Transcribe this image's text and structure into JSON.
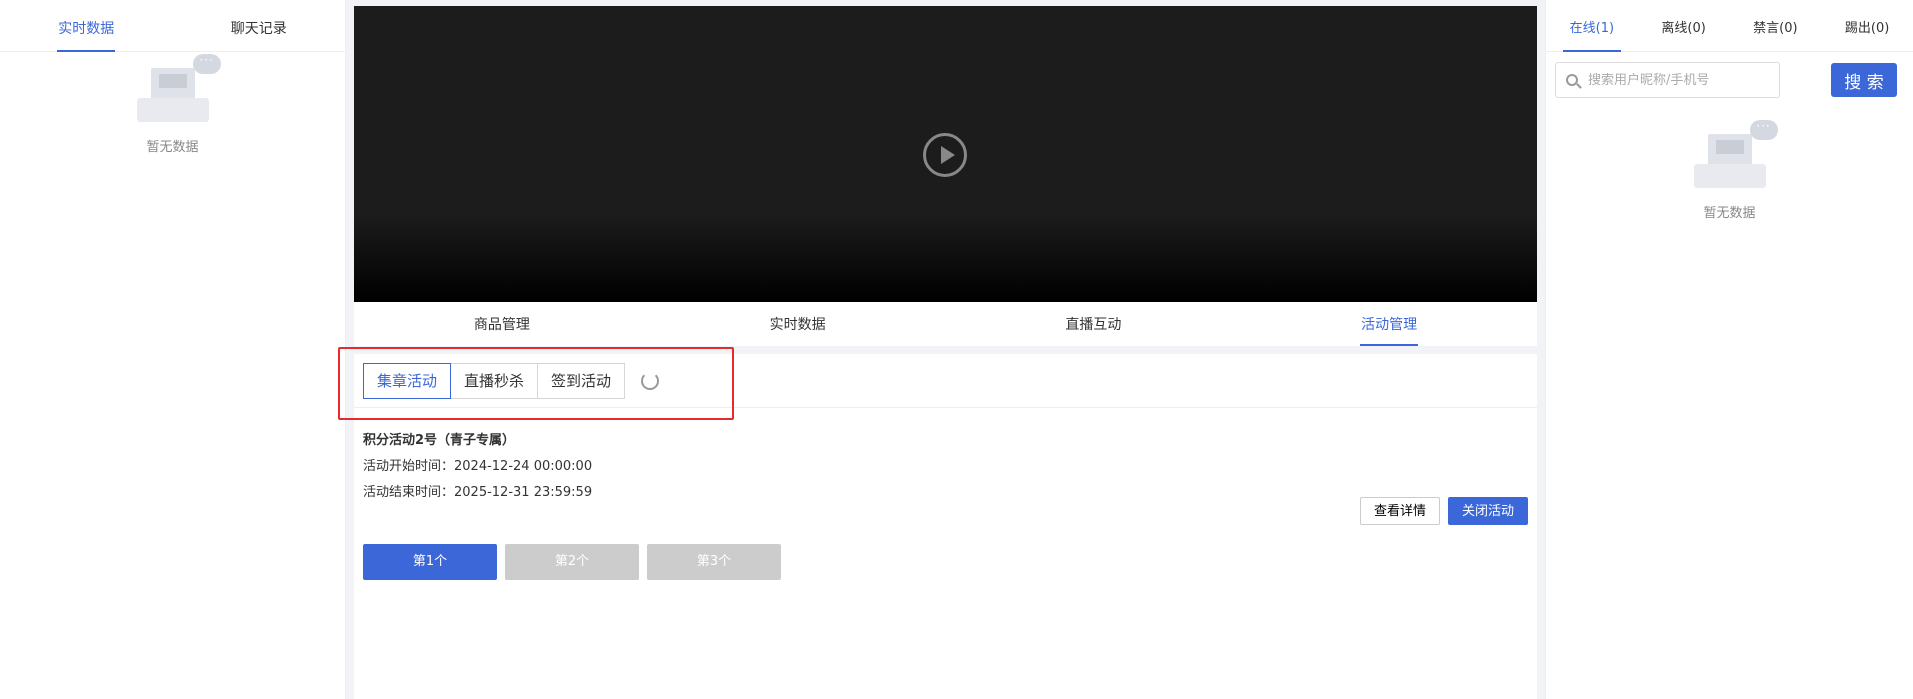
{
  "left_panel": {
    "tabs": [
      {
        "label": "实时数据",
        "active": true
      },
      {
        "label": "聊天记录",
        "active": false
      }
    ],
    "empty_text": "暂无数据"
  },
  "center": {
    "tabs": [
      {
        "label": "商品管理",
        "active": false
      },
      {
        "label": "实时数据",
        "active": false
      },
      {
        "label": "直播互动",
        "active": false
      },
      {
        "label": "活动管理",
        "active": true
      }
    ],
    "activity_types": [
      {
        "label": "集章活动",
        "active": true
      },
      {
        "label": "直播秒杀",
        "active": false
      },
      {
        "label": "签到活动",
        "active": false
      }
    ],
    "activity": {
      "title": "积分活动2号（青子专属）",
      "start_label": "活动开始时间：",
      "start_time": "2024-12-24 00:00:00",
      "end_label": "活动结束时间：",
      "end_time": "2025-12-31 23:59:59",
      "detail_button": "查看详情",
      "close_button": "关闭活动",
      "rounds": [
        {
          "label": "第1个",
          "active": true
        },
        {
          "label": "第2个",
          "active": false
        },
        {
          "label": "第3个",
          "active": false
        }
      ]
    }
  },
  "right_panel": {
    "tabs": [
      {
        "label": "在线(1)",
        "active": true
      },
      {
        "label": "离线(0)",
        "active": false
      },
      {
        "label": "禁言(0)",
        "active": false
      },
      {
        "label": "踢出(0)",
        "active": false
      }
    ],
    "search_placeholder": "搜索用户昵称/手机号",
    "search_button": "搜 索",
    "empty_text": "暂无数据"
  },
  "colors": {
    "accent": "#3b67d9",
    "highlight": "#e52b2b",
    "disabled": "#cccccc"
  }
}
